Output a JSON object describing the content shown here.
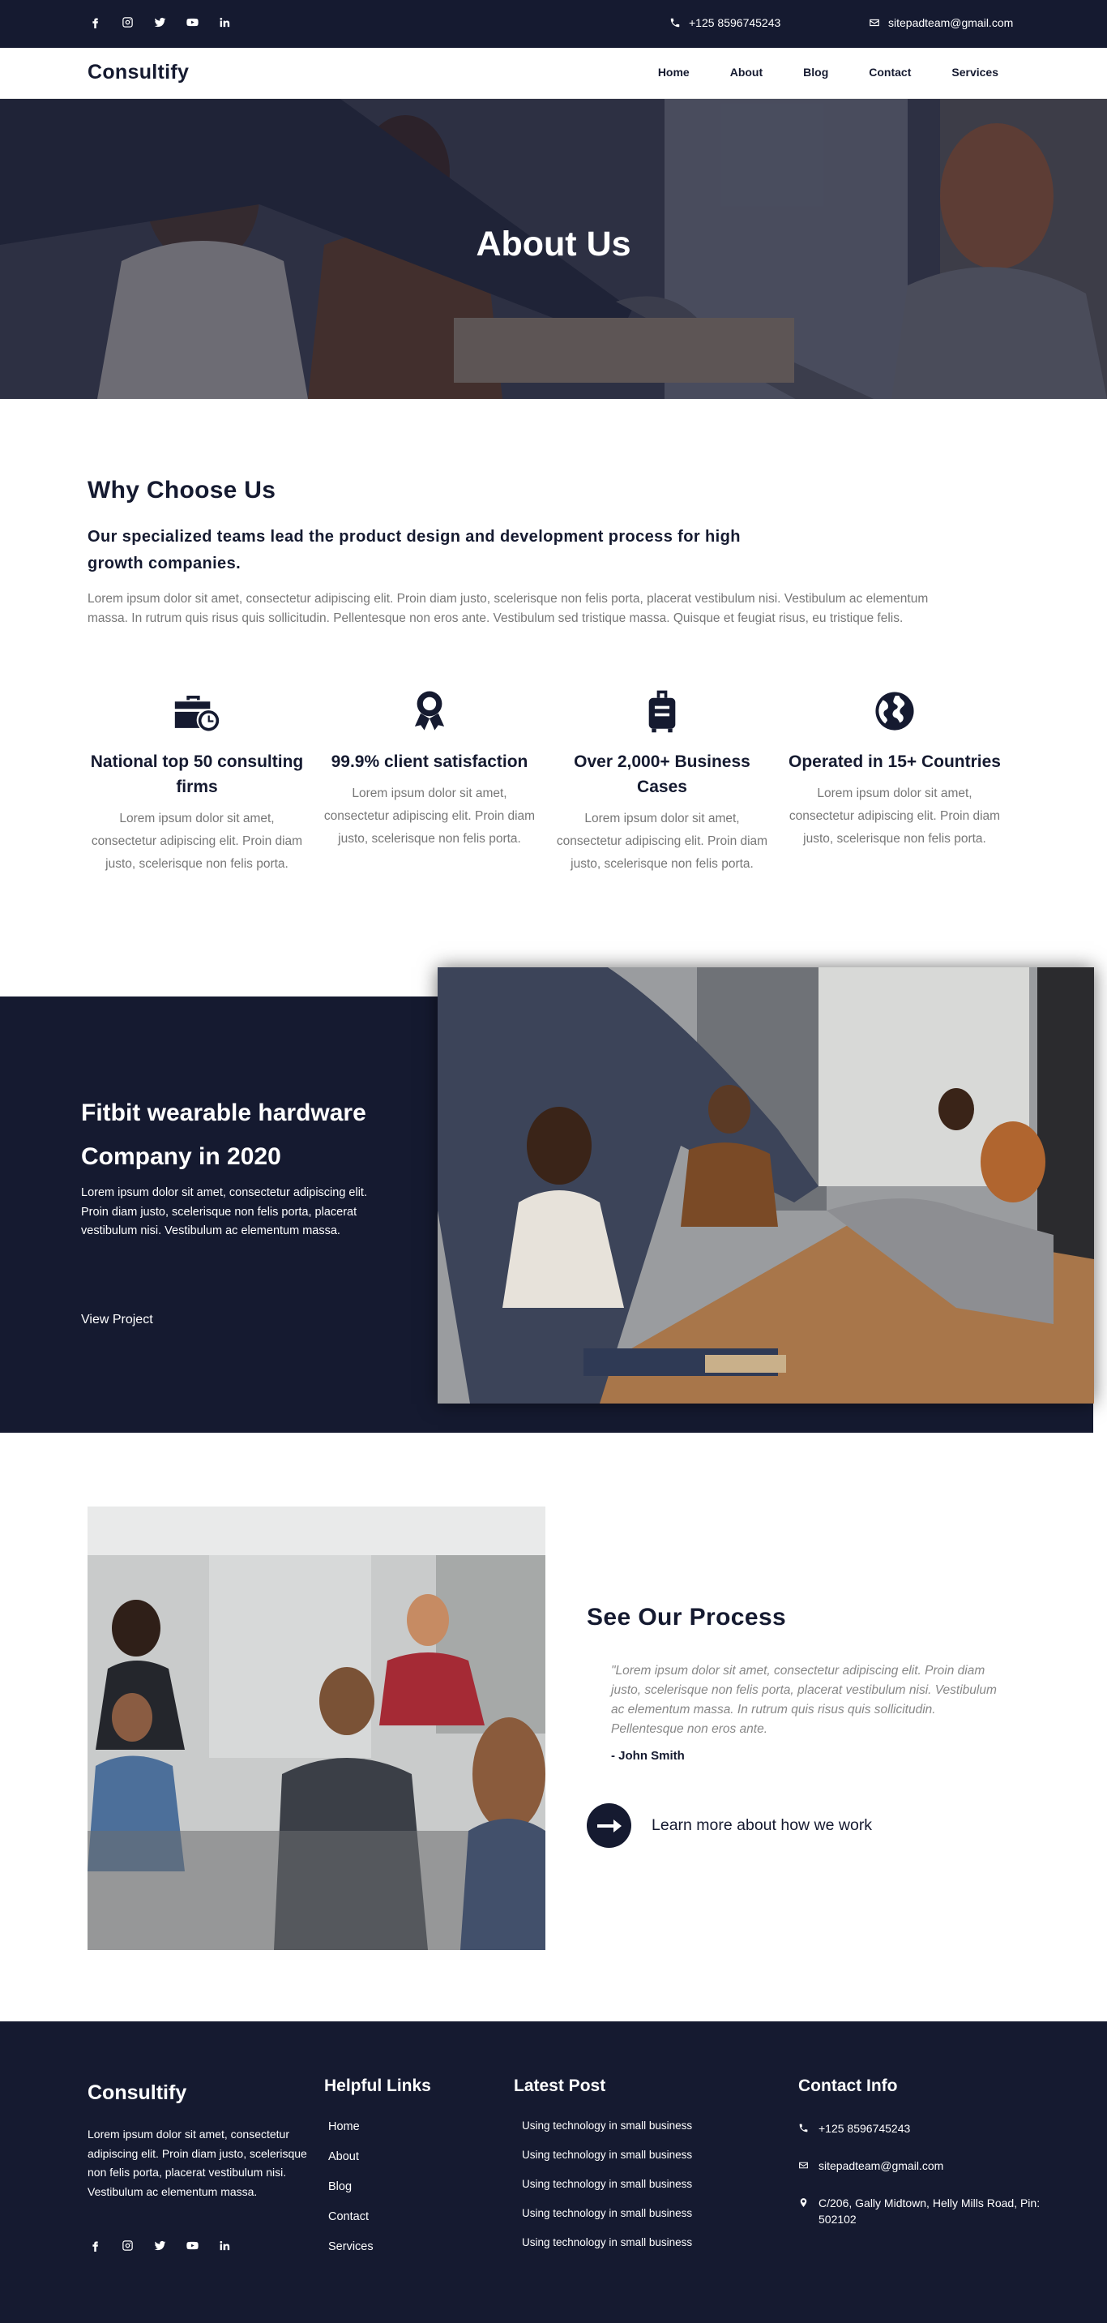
{
  "topbar": {
    "social_icons": [
      "facebook-icon",
      "instagram-icon",
      "twitter-icon",
      "youtube-icon",
      "linkedin-icon"
    ],
    "phone": "+125 8596745243",
    "email": "sitepadteam@gmail.com"
  },
  "navbar": {
    "brand": "Consultify",
    "items": [
      "Home",
      "About",
      "Blog",
      "Contact",
      "Services"
    ]
  },
  "hero": {
    "title": "About Us"
  },
  "why": {
    "title": "Why Choose Us",
    "subtitle": "Our specialized teams lead the product design and development process for high growth companies.",
    "body": "Lorem ipsum dolor sit amet, consectetur adipiscing elit. Proin diam justo, scelerisque non felis porta, placerat vestibulum nisi. Vestibulum ac elementum massa. In rutrum quis risus quis sollicitudin. Pellentesque non eros ante. Vestibulum sed tristique massa. Quisque et feugiat risus, eu tristique felis.",
    "features": [
      {
        "icon": "briefcase-clock-icon",
        "title": "National top 50 consulting firms",
        "text": "Lorem ipsum dolor sit amet, consectetur adipiscing elit. Proin diam justo, scelerisque non felis porta."
      },
      {
        "icon": "award-icon",
        "title": "99.9% client satisfaction",
        "text": "Lorem ipsum dolor sit amet, consectetur adipiscing elit. Proin diam justo, scelerisque non felis porta."
      },
      {
        "icon": "luggage-icon",
        "title": "Over 2,000+ Business Cases",
        "text": "Lorem ipsum dolor sit amet, consectetur adipiscing elit. Proin diam justo, scelerisque non felis porta."
      },
      {
        "icon": "globe-icon",
        "title": "Operated in 15+ Countries",
        "text": "Lorem ipsum dolor sit amet, consectetur adipiscing elit. Proin diam justo, scelerisque non felis porta."
      }
    ]
  },
  "project": {
    "title": "Fitbit wearable hardware Company in 2020",
    "text": "Lorem ipsum dolor sit amet, consectetur adipiscing elit. Proin diam justo, scelerisque non felis porta, placerat vestibulum nisi. Vestibulum ac elementum massa.",
    "link": "View Project"
  },
  "process": {
    "title": "See Our Process",
    "quote": "\"Lorem ipsum dolor sit amet, consectetur adipiscing elit. Proin diam justo, scelerisque non felis porta, placerat vestibulum nisi. Vestibulum ac elementum massa. In rutrum quis risus quis sollicitudin. Pellentesque non eros ante.",
    "author": "- John Smith",
    "cta": "Learn more about how we work"
  },
  "footer": {
    "brand": "Consultify",
    "desc": "Lorem ipsum dolor sit amet, consectetur adipiscing elit. Proin diam justo, scelerisque non felis porta, placerat vestibulum nisi. Vestibulum ac elementum massa.",
    "links_title": "Helpful Links",
    "links": [
      "Home",
      "About",
      "Blog",
      "Contact",
      "Services"
    ],
    "posts_title": "Latest Post",
    "posts": [
      "Using technology in small business",
      "Using technology in small business",
      "Using technology in small business",
      "Using technology in small business",
      "Using technology in small business"
    ],
    "contact_title": "Contact Info",
    "phone": "+125 8596745243",
    "email": "sitepadteam@gmail.com",
    "address": "C/206, Gally Midtown, Helly Mills Road, Pin: 502102"
  },
  "colors": {
    "navy": "#151a30",
    "text_gray": "#777777"
  }
}
